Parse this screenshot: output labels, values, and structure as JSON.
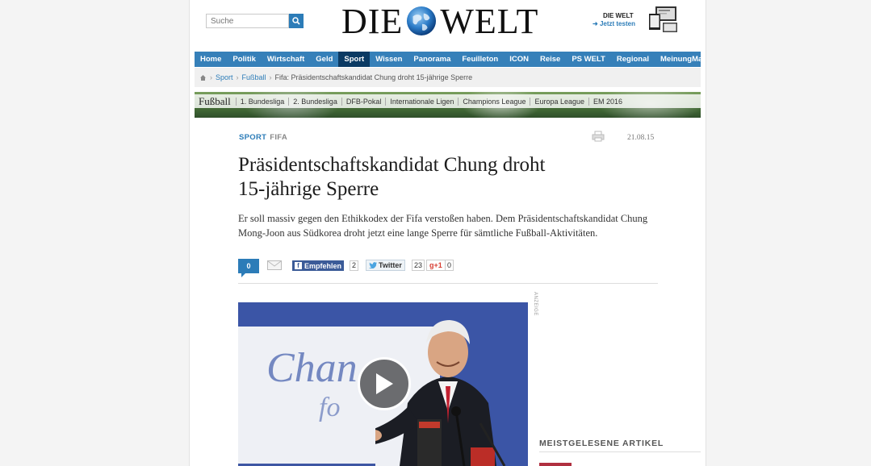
{
  "header": {
    "search_placeholder": "Suche",
    "logo_left": "DIE",
    "logo_right": "WELT",
    "promo_title": "DIE WELT",
    "promo_link": "Jetzt testen"
  },
  "nav": {
    "items": [
      "Home",
      "Politik",
      "Wirtschaft",
      "Geld",
      "Sport",
      "Wissen",
      "Panorama",
      "Feuilleton",
      "ICON",
      "Reise",
      "PS WELT",
      "Regional",
      "Meinung",
      "Ma"
    ],
    "active": "Sport"
  },
  "breadcrumb": {
    "sport": "Sport",
    "fussball": "Fußball",
    "current": "Fifa: Präsidentschaftskandidat Chung droht 15-jährige Sperre"
  },
  "sport_bar": {
    "title": "Fußball",
    "links": [
      "1. Bundesliga",
      "2. Bundesliga",
      "DFB-Pokal",
      "Internationale Ligen",
      "Champions League",
      "Europa League",
      "EM 2016"
    ]
  },
  "article": {
    "kicker": "SPORT",
    "kicker_sub": "FIFA",
    "date": "21.08.15",
    "headline": "Präsidentschaftskandidat Chung droht 15-jährige Sperre",
    "lead": "Er soll massiv gegen den Ethikkodex der Fifa verstoßen haben. Dem Präsidentschaftskandidat Chung Mong-Joon aus Südkorea droht jetzt eine lange Sperre für sämtliche Fußball-Aktivitäten."
  },
  "social": {
    "comments": "0",
    "facebook_label": "Empfehlen",
    "facebook_count": "2",
    "twitter_label": "Twitter",
    "twitter_count": "23",
    "gplus_label": "g+1",
    "gplus_count": "0"
  },
  "video": {
    "ad_label": "ANZEIGE",
    "backdrop_word1": "Chan",
    "backdrop_word2": "fo"
  },
  "sidebar": {
    "title": "MEISTGELESENE ARTIKEL"
  },
  "colors": {
    "brand_blue": "#3680b9",
    "nav_active": "#0b3a63",
    "facebook": "#3b5b98"
  }
}
